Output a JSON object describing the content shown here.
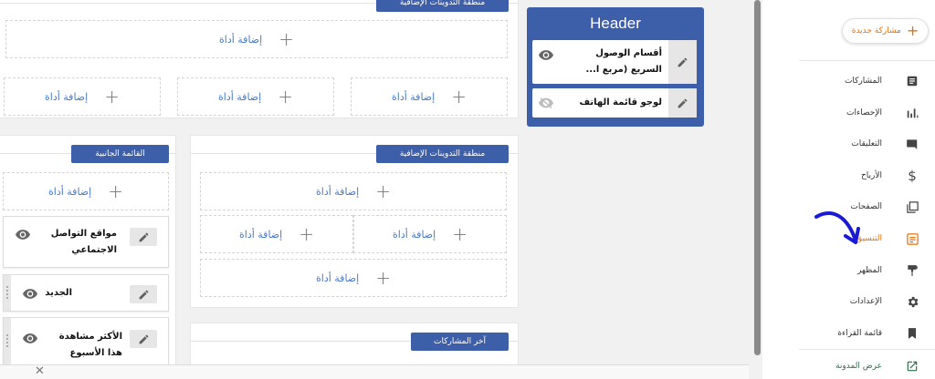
{
  "header_section": {
    "title": "Header",
    "widgets": [
      {
        "title": "أقسام الوصول السريع (مربع ا..."
      },
      {
        "title": "لوجو قائمة الهاتف"
      }
    ]
  },
  "add_gadget_label": "إضافة أداة",
  "sections": {
    "extra_blogs_top": "منطقة التدوينات الإضافية",
    "sidebar": "القائمة الجانبية",
    "extra_blogs": "منطقة التدوينات الإضافية",
    "latest_posts": "آخر المشاركات"
  },
  "sidebar_widgets": [
    {
      "title": "مواقع التواصل الاجتماعي"
    },
    {
      "title": "الجديد"
    },
    {
      "title": "الأكثر مشاهدة هذا الأسبوع"
    }
  ],
  "nav": {
    "new_post": "مشاركة جديدة",
    "items": [
      {
        "label": "المشاركات",
        "icon": "posts-icon"
      },
      {
        "label": "الإحصاءات",
        "icon": "stats-icon"
      },
      {
        "label": "التعليقات",
        "icon": "comments-icon"
      },
      {
        "label": "الأرباح",
        "icon": "earnings-icon"
      },
      {
        "label": "الصفحات",
        "icon": "pages-icon"
      },
      {
        "label": "التنسيق",
        "icon": "layout-icon"
      },
      {
        "label": "المظهر",
        "icon": "theme-icon"
      },
      {
        "label": "الإعدادات",
        "icon": "settings-icon"
      },
      {
        "label": "قائمة القراءة",
        "icon": "reading-list-icon"
      }
    ],
    "view_blog": "عرض المدونة"
  },
  "colors": {
    "accent": "#e8710a",
    "section_blue": "#3d5ea9",
    "link_blue": "#4a7ac5",
    "annotation_arrow": "#1a1ad6"
  }
}
